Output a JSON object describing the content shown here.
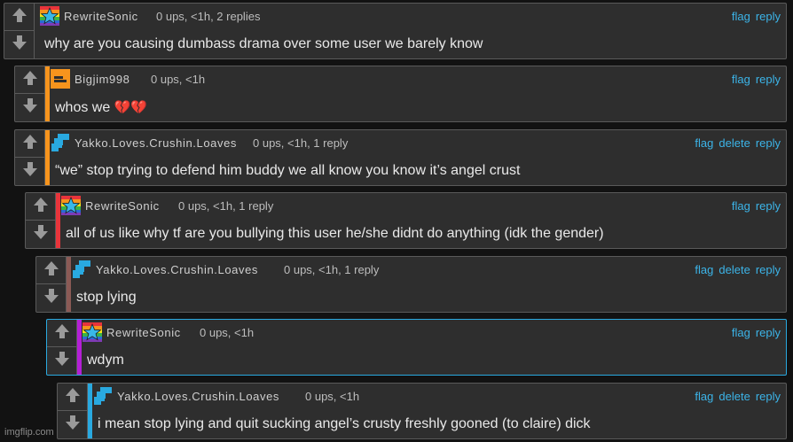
{
  "comments": [
    {
      "author": "RewriteSonic",
      "meta": "0 ups, <1h, 2 replies",
      "text": "why are you causing dumbass drama over some user we barely know",
      "actions": [
        "flag",
        "reply"
      ],
      "avatar": "rainbow-star-icon",
      "stripe_color": ""
    },
    {
      "author": "Bigjim998",
      "meta": "0 ups, <1h",
      "text": "whos we",
      "emoji": "💔💔",
      "actions": [
        "flag",
        "reply"
      ],
      "avatar": "orange-block-icon",
      "stripe_color": "#f7941d"
    },
    {
      "author": "Yakko.Loves.Crushin.Loaves",
      "meta": "0 ups, <1h, 1 reply",
      "text": "“we” stop trying to defend him buddy we all know you know it’s angel crust",
      "actions": [
        "flag",
        "delete",
        "reply"
      ],
      "avatar": "blue-pixel-icon",
      "stripe_color": "#f7941d"
    },
    {
      "author": "RewriteSonic",
      "meta": "0 ups, <1h, 1 reply",
      "text": "all of us like why tf are you bullying this user he/she didnt do anything (idk the gender)",
      "actions": [
        "flag",
        "reply"
      ],
      "avatar": "rainbow-star-icon",
      "stripe_color": "#e8343b"
    },
    {
      "author": "Yakko.Loves.Crushin.Loaves",
      "meta": "0 ups, <1h, 1 reply",
      "text": "stop lying",
      "actions": [
        "flag",
        "delete",
        "reply"
      ],
      "avatar": "blue-pixel-icon",
      "stripe_color": "#8b5a55"
    },
    {
      "author": "RewriteSonic",
      "meta": "0 ups, <1h",
      "text": "wdym",
      "actions": [
        "flag",
        "reply"
      ],
      "avatar": "rainbow-star-icon",
      "stripe_color": "#b41fd6"
    },
    {
      "author": "Yakko.Loves.Crushin.Loaves",
      "meta": "0 ups, <1h",
      "text": "i mean stop lying and quit sucking angel’s crusty freshly gooned (to claire) dick",
      "actions": [
        "flag",
        "delete",
        "reply"
      ],
      "avatar": "blue-pixel-icon",
      "stripe_color": "#29a9e0"
    }
  ],
  "watermark": "imgflip.com"
}
